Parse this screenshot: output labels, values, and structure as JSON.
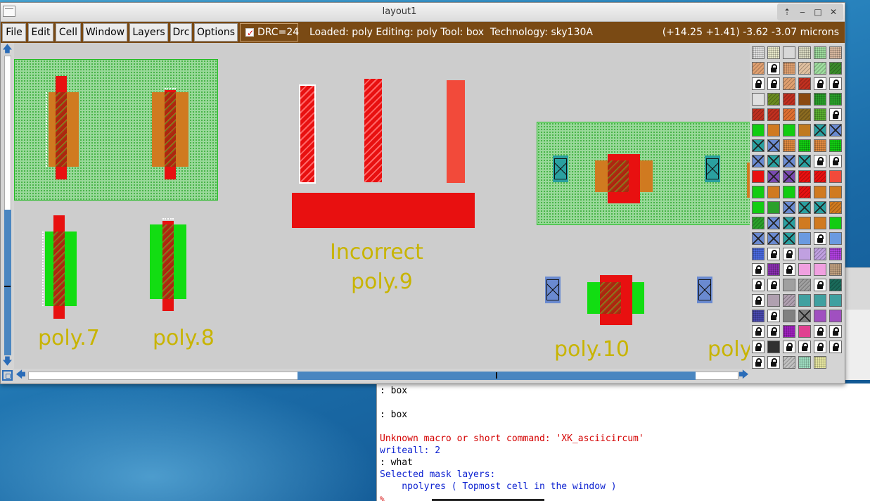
{
  "window": {
    "title": "layout1",
    "buttons": [
      "⇡",
      "‒",
      "□",
      "✕"
    ]
  },
  "menu": {
    "items": [
      "File",
      "Edit",
      "Cell",
      "Window",
      "Layers",
      "Drc",
      "Options"
    ]
  },
  "drc": {
    "label": "DRC=24",
    "checked": true
  },
  "status": {
    "text": "Loaded: poly Editing: poly Tool: box  Technology: sky130A",
    "coords": "(+14.25 +1.41) -3.62 -3.07 microns"
  },
  "canvas_labels": {
    "poly7": "poly.7",
    "poly8": "poly.8",
    "incorrect": "Incorrect",
    "poly9": "poly.9",
    "poly10": "poly.10",
    "poly_partial": "poly"
  },
  "terminal": {
    "lines": [
      {
        "text": ": box",
        "kind": "normal"
      },
      {
        "text": "",
        "kind": "blank"
      },
      {
        "text": ": box",
        "kind": "normal"
      },
      {
        "text": "",
        "kind": "blank"
      },
      {
        "text": "Unknown macro or short command: 'XK_asciicircum'",
        "kind": "err"
      },
      {
        "text": "writeall: 2",
        "kind": "info"
      },
      {
        "text": ": what",
        "kind": "normal"
      },
      {
        "text": "Selected mask layers:",
        "kind": "info"
      },
      {
        "text": "    npolyres ( Topmost cell in the window )",
        "kind": "info"
      }
    ],
    "prompt": "%"
  },
  "scroll": {
    "vertical_thumb_fraction": 0.49,
    "horizontal_thumb_fraction": 0.56
  }
}
